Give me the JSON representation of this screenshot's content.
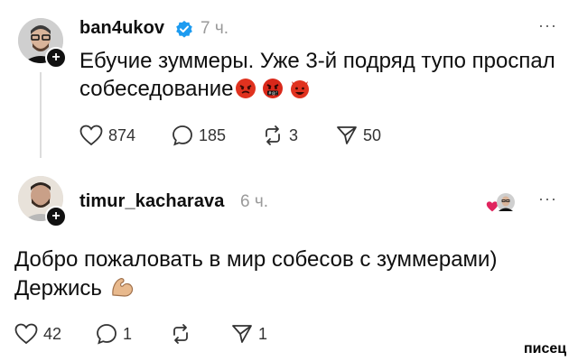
{
  "posts": [
    {
      "username": "ban4ukov",
      "verified": true,
      "time": "7 ч.",
      "text_line1": "Ебучие зуммеры. Уже 3-й подряд тупо проспал",
      "text_line2": "собеседование",
      "emojis": [
        "angry-face",
        "face-with-symbols-on-mouth",
        "angry-devil-face"
      ],
      "likes": "874",
      "comments": "185",
      "reposts": "3",
      "shares": "50"
    },
    {
      "username": "timur_kacharava",
      "time": "6 ч.",
      "text_line1": "Добро пожаловать в мир собесов с зуммерами)",
      "text_line2": "Держись",
      "emojis": [
        "flexed-biceps"
      ],
      "likes": "42",
      "comments": "1",
      "reposts": "",
      "shares": "1"
    }
  ],
  "more_label": "···",
  "watermark": "писец",
  "colors": {
    "verified": "#1d9bf0",
    "heart": "#e0245e",
    "muted": "#9a9a9a"
  }
}
